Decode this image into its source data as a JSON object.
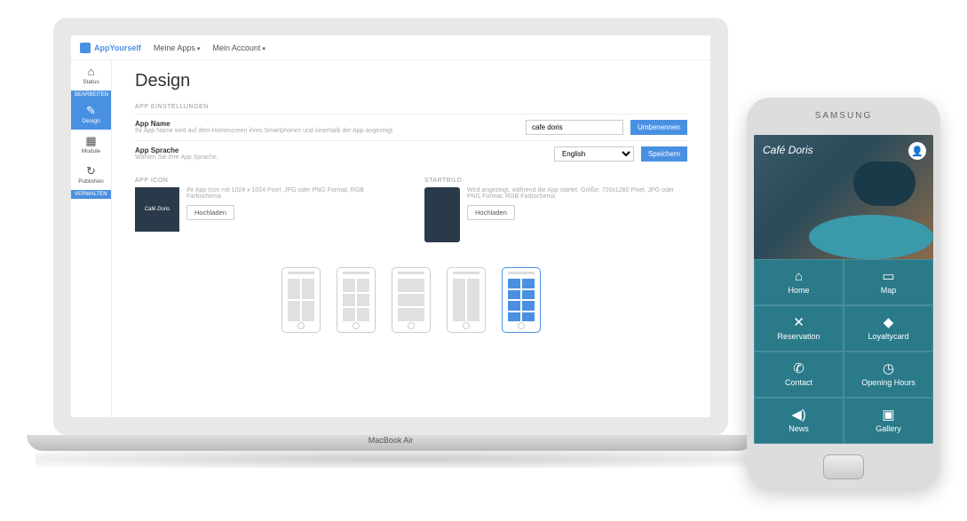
{
  "laptop_base_label": "MacBook Air",
  "topbar": {
    "brand": "AppYourself",
    "nav": [
      "Meine Apps",
      "Mein Account"
    ]
  },
  "sidebar": {
    "items": [
      {
        "icon": "⌂",
        "label": "Status"
      },
      {
        "section": "BEARBEITEN"
      },
      {
        "icon": "✎",
        "label": "Design"
      },
      {
        "icon": "▦",
        "label": "Module"
      },
      {
        "icon": "↻",
        "label": "Publishen"
      },
      {
        "section": "VERWALTEN"
      }
    ]
  },
  "page": {
    "title": "Design",
    "settings_label": "APP EINSTELLUNGEN",
    "name": {
      "label": "App Name",
      "hint": "Ihr App Name wird auf dem Homescreen ihres Smartphones und innerhalb der App angezeigt.",
      "value": "cafe doris",
      "button": "Umbenennen"
    },
    "lang": {
      "label": "App Sprache",
      "hint": "Wählen Sie Ihre App Sprache.",
      "value": "English",
      "button": "Speichern"
    },
    "icon": {
      "section": "APP ICON",
      "hint": "Ihr App Icon mit 1024 x 1024 Pixel, JPG oder PNG Format, RGB Farbschema",
      "preview_text": "Café Doris",
      "button": "Hochladen"
    },
    "start": {
      "section": "STARTBILD",
      "hint": "Wird angezeigt, während die App startet. Größe: 720x1280 Pixel, JPG oder PNG Format, RGB Farbschema",
      "button": "Hochladen"
    }
  },
  "phone": {
    "brand": "SAMSUNG",
    "logo": "Café Doris",
    "tiles": [
      {
        "icon": "⌂",
        "label": "Home"
      },
      {
        "icon": "▭",
        "label": "Map"
      },
      {
        "icon": "✕",
        "label": "Reservation"
      },
      {
        "icon": "◆",
        "label": "Loyaltycard"
      },
      {
        "icon": "✆",
        "label": "Contact"
      },
      {
        "icon": "◷",
        "label": "Opening Hours"
      },
      {
        "icon": "◀)",
        "label": "News"
      },
      {
        "icon": "▣",
        "label": "Gallery"
      }
    ]
  }
}
